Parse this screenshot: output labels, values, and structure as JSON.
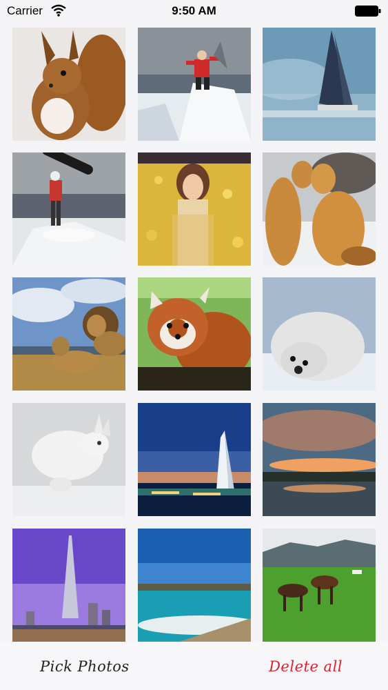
{
  "status_bar": {
    "carrier": "Carrier",
    "time": "9:50 AM",
    "wifi_icon": "wifi-icon",
    "battery_icon": "battery-icon"
  },
  "photos": [
    {
      "name": "squirrel"
    },
    {
      "name": "snowboarder-on-peak"
    },
    {
      "name": "sailboat"
    },
    {
      "name": "snowboarder-jump"
    },
    {
      "name": "girl-in-flower-field"
    },
    {
      "name": "foxes"
    },
    {
      "name": "lions"
    },
    {
      "name": "red-panda"
    },
    {
      "name": "seal-pup"
    },
    {
      "name": "white-rabbit"
    },
    {
      "name": "burj-al-arab-night"
    },
    {
      "name": "sunset-lake"
    },
    {
      "name": "burj-khalifa"
    },
    {
      "name": "beach-coast"
    },
    {
      "name": "horses-meadow"
    }
  ],
  "toolbar": {
    "pick_label": "Pick Photos",
    "delete_label": "Delete all",
    "delete_color": "#e0202a"
  }
}
